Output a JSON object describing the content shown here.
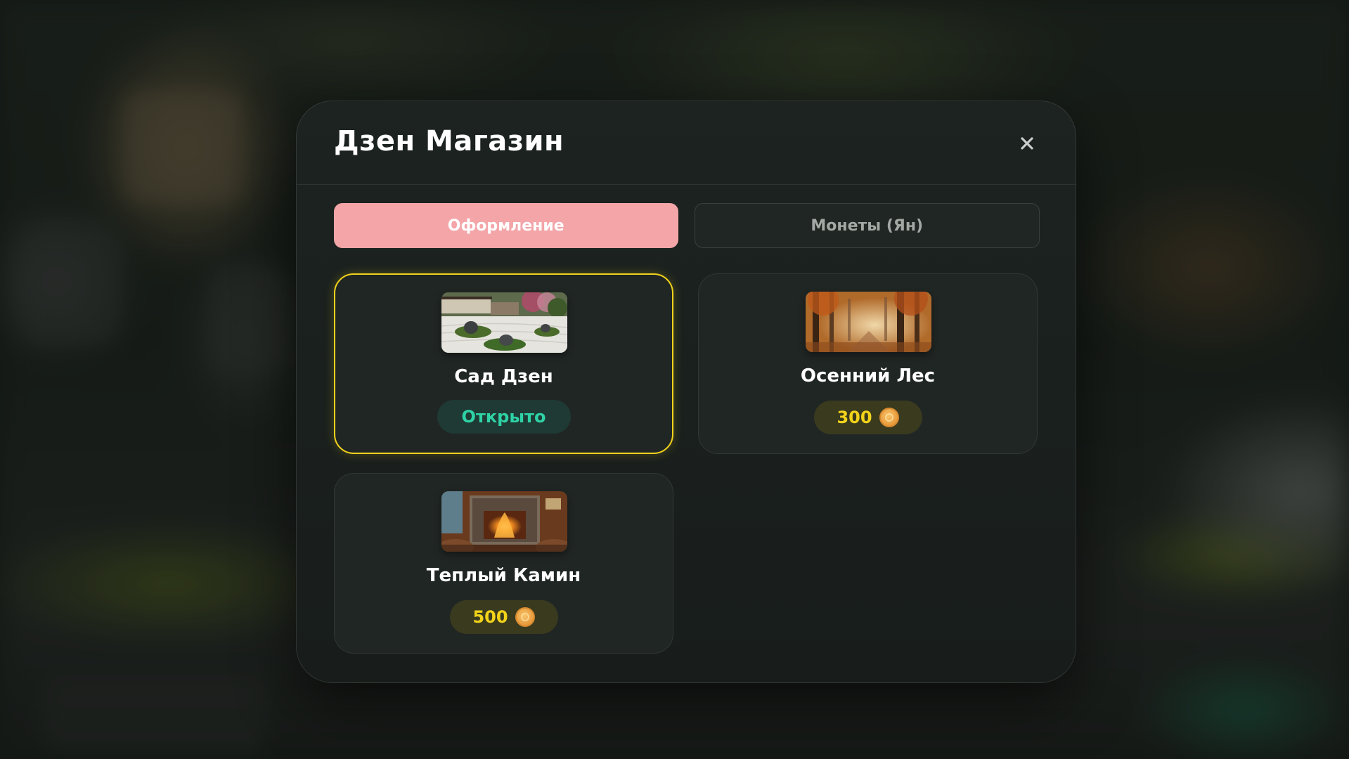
{
  "modal": {
    "title": "Дзен Магазин",
    "close_icon": "close-icon"
  },
  "tabs": [
    {
      "label": "Оформление",
      "active": true
    },
    {
      "label": "Монеты (Ян)",
      "active": false
    }
  ],
  "items": [
    {
      "title": "Сад Дзен",
      "status": "Открыто",
      "selected": true,
      "thumbnail": "zen-garden"
    },
    {
      "title": "Осенний Лес",
      "price": "300",
      "currency_icon": "coin-icon",
      "thumbnail": "autumn-forest"
    },
    {
      "title": "Теплый Камин",
      "price": "500",
      "currency_icon": "coin-icon",
      "thumbnail": "warm-fireplace"
    }
  ],
  "colors": {
    "accent_tab": "#f3a5a8",
    "selected_border": "#f0d21c",
    "owned_text": "#2fd2a6",
    "price_text": "#f2d31a"
  }
}
